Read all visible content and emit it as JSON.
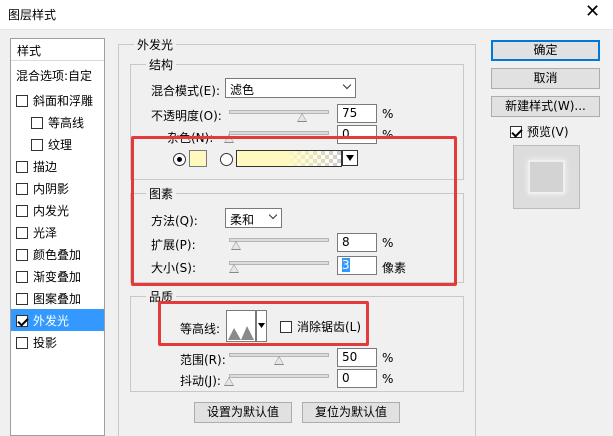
{
  "window": {
    "title": "图层样式",
    "close_glyph": "✕"
  },
  "sidebar": {
    "header": "样式",
    "blend_options": "混合选项:自定",
    "items": [
      {
        "label": "斜面和浮雕",
        "checked": false
      },
      {
        "label": "等高线",
        "checked": false
      },
      {
        "label": "纹理",
        "checked": false
      },
      {
        "label": "描边",
        "checked": false
      },
      {
        "label": "内阴影",
        "checked": false
      },
      {
        "label": "内发光",
        "checked": false
      },
      {
        "label": "光泽",
        "checked": false
      },
      {
        "label": "颜色叠加",
        "checked": false
      },
      {
        "label": "渐变叠加",
        "checked": false
      },
      {
        "label": "图案叠加",
        "checked": false
      },
      {
        "label": "外发光",
        "checked": true
      },
      {
        "label": "投影",
        "checked": false
      }
    ]
  },
  "panel": {
    "title": "外发光",
    "structure": {
      "label": "结构",
      "blend_mode_label": "混合模式(E):",
      "blend_mode_value": "滤色",
      "opacity_label": "不透明度(O):",
      "opacity_value": "75",
      "opacity_unit": "%",
      "noise_label": "杂色(N):",
      "noise_value": "0",
      "noise_unit": "%",
      "glow_color": "#fff9c0"
    },
    "elements": {
      "label": "图素",
      "method_label": "方法(Q):",
      "method_value": "柔和",
      "spread_label": "扩展(P):",
      "spread_value": "8",
      "spread_unit": "%",
      "size_label": "大小(S):",
      "size_value": "3",
      "size_unit": "像素"
    },
    "quality": {
      "label": "品质",
      "contour_label": "等高线:",
      "anti_alias_label": "消除锯齿(L)",
      "range_label": "范围(R):",
      "range_value": "50",
      "range_unit": "%",
      "jitter_label": "抖动(J):",
      "jitter_value": "0",
      "jitter_unit": "%"
    },
    "make_default": "设置为默认值",
    "reset_default": "复位为默认值"
  },
  "right": {
    "ok": "确定",
    "cancel": "取消",
    "new_style": "新建样式(W)...",
    "preview_label": "预览(V)",
    "preview_checked": true
  },
  "colors": {
    "highlight": "#e53a3a",
    "selection": "#3399ff"
  }
}
